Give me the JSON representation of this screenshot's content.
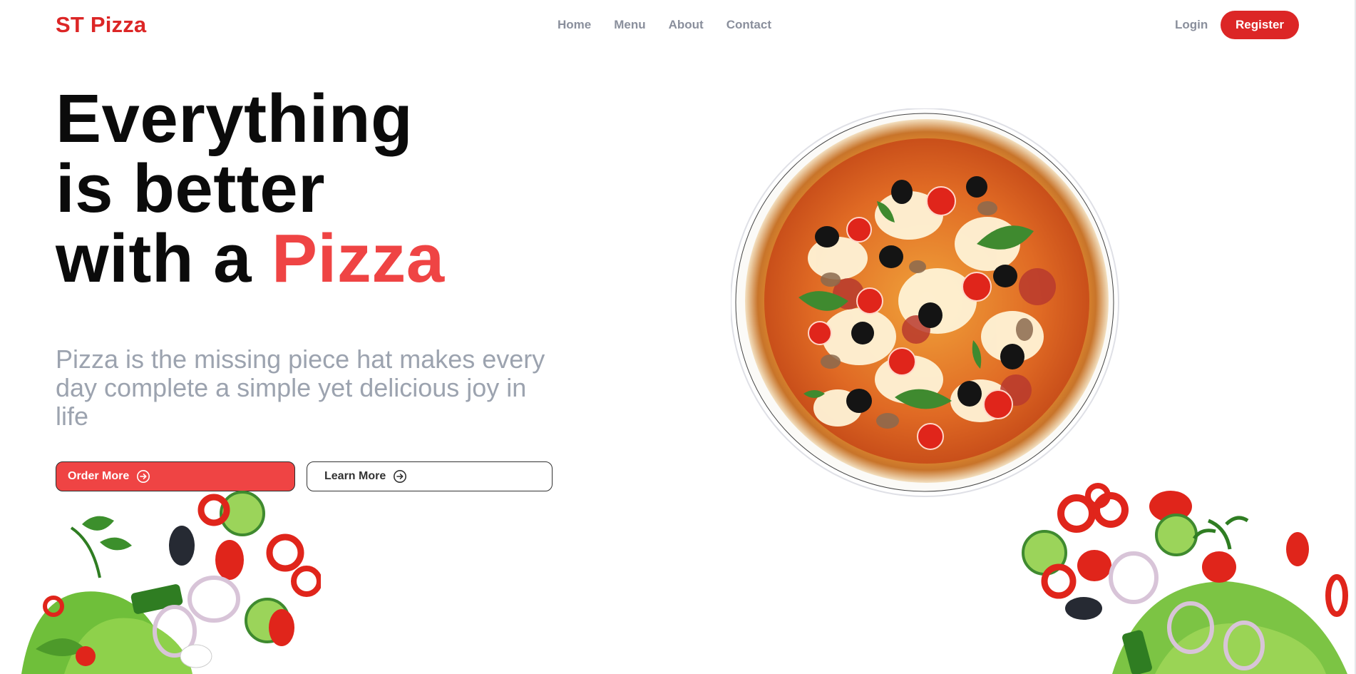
{
  "brand": {
    "name": "ST Pizza",
    "accent_color": "#dc2626"
  },
  "nav": {
    "links": [
      "Home",
      "Menu",
      "About",
      "Contact"
    ],
    "login_label": "Login",
    "register_label": "Register"
  },
  "hero": {
    "headline_line1": "Everything",
    "headline_line2": "is better",
    "headline_line3": "with a",
    "headline_accent": "Pizza",
    "subtext": "Pizza is the missing piece hat makes every day complete a simple yet delicious joy in life",
    "order_button": "Order More",
    "learn_button": "Learn More",
    "button_icon": "arrow-right-circle-icon"
  },
  "images": {
    "pizza": "pizza-image",
    "salad_left": "salad-vegetables-image",
    "salad_right": "salad-vegetables-image"
  }
}
